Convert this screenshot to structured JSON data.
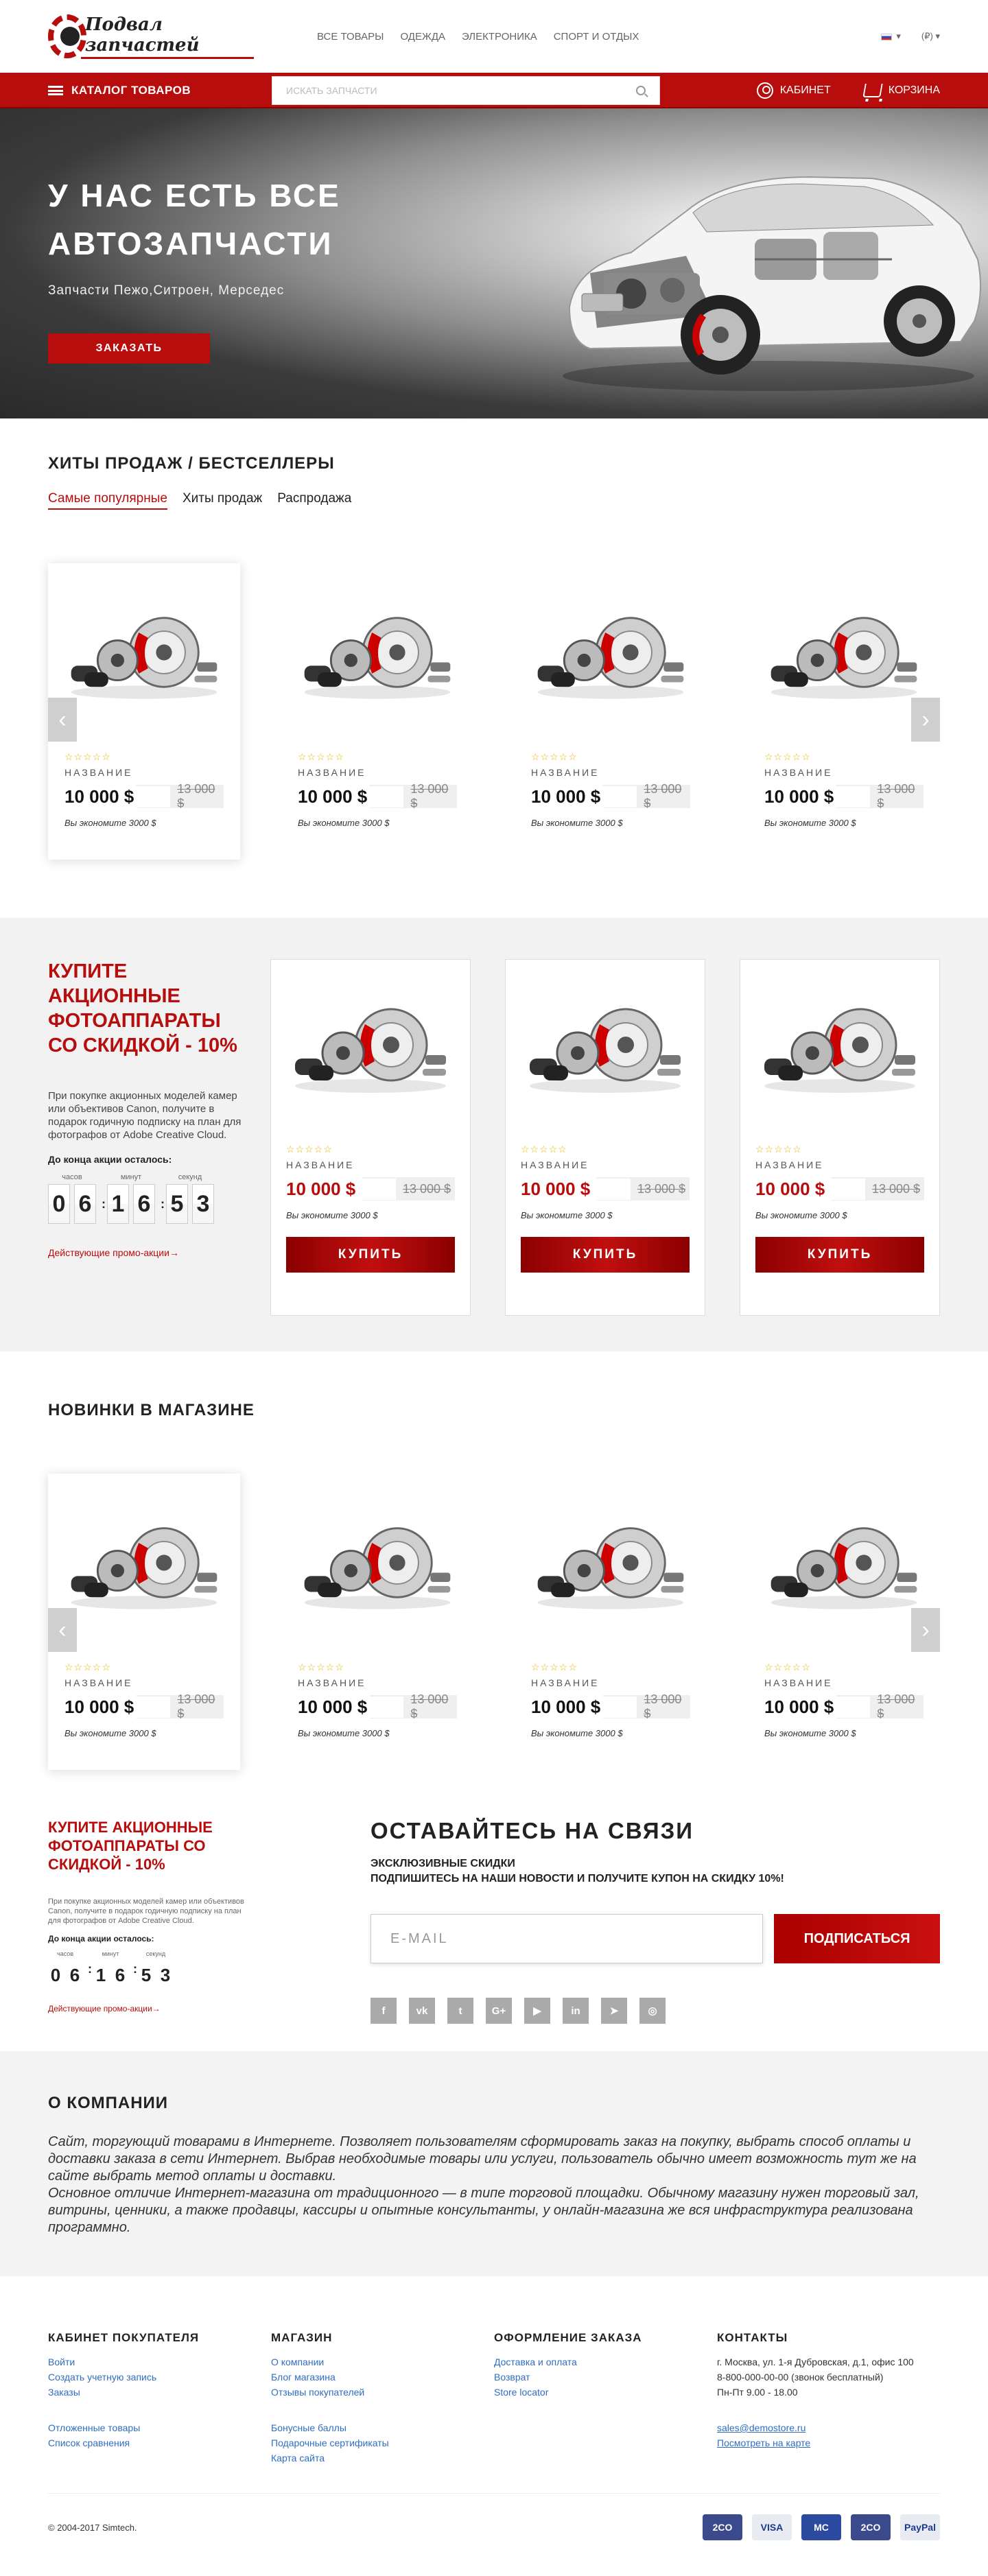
{
  "header": {
    "logo_text": "Подвал запчастей",
    "nav": [
      "Все товары",
      "Одежда",
      "Электроника",
      "Спорт и отдых"
    ],
    "lang_caret": "▾",
    "currency": "(₽) ▾"
  },
  "bar": {
    "catalog": "Каталог товаров",
    "search_placeholder": "искать запчасти",
    "cabinet": "Кабинет",
    "cart": "Корзина"
  },
  "hero": {
    "title": "У нас есть все автозапчасти",
    "subtitle": "Запчасти Пежо,Ситроен, Мерседес",
    "button": "Заказать"
  },
  "bestsellers": {
    "title": "Хиты продаж / бестселлеры",
    "tabs": [
      "Самые популярные",
      "Хиты продаж",
      "Распродажа"
    ],
    "products": [
      {
        "stars": "☆☆☆☆☆",
        "name": "название",
        "price": "10 000 $",
        "old": "13 000 $",
        "save": "Вы экономите 3000 $"
      },
      {
        "stars": "☆☆☆☆☆",
        "name": "название",
        "price": "10 000 $",
        "old": "13 000 $",
        "save": "Вы экономите 3000 $"
      },
      {
        "stars": "☆☆☆☆☆",
        "name": "название",
        "price": "10 000 $",
        "old": "13 000 $",
        "save": "Вы экономите 3000 $"
      },
      {
        "stars": "☆☆☆☆☆",
        "name": "название",
        "price": "10 000 $",
        "old": "13 000 $",
        "save": "Вы экономите 3000 $"
      }
    ]
  },
  "arrows": {
    "left": "‹",
    "right": "›"
  },
  "promo": {
    "title": "Купите акционные фотоаппараты со скидкой - 10%",
    "text": "При покупке акционных моделей камер или объективов Canon, получите в подарок годичную подписку на план для фотографов от Adobe Creative Cloud.",
    "deadline": "До конца акции осталось:",
    "labels": [
      "часов",
      "минут",
      "секунд"
    ],
    "hours": [
      "0",
      "6"
    ],
    "minutes": [
      "1",
      "6"
    ],
    "seconds": [
      "5",
      "3"
    ],
    "colon": ":",
    "link": "Действующие промо-акции→",
    "buy": "Купить",
    "products": [
      {
        "stars": "☆☆☆☆☆",
        "name": "название",
        "price": "10 000 $",
        "old": "13 000 $",
        "save": "Вы экономите 3000 $"
      },
      {
        "stars": "☆☆☆☆☆",
        "name": "название",
        "price": "10 000 $",
        "old": "13 000 $",
        "save": "Вы экономите 3000 $"
      },
      {
        "stars": "☆☆☆☆☆",
        "name": "название",
        "price": "10 000 $",
        "old": "13 000 $",
        "save": "Вы экономите 3000 $"
      }
    ]
  },
  "newarrivals": {
    "title": "Новинки в магазине",
    "products": [
      {
        "stars": "☆☆☆☆☆",
        "name": "название",
        "price": "10 000 $",
        "old": "13 000 $",
        "save": "Вы экономите 3000 $"
      },
      {
        "stars": "☆☆☆☆☆",
        "name": "название",
        "price": "10 000 $",
        "old": "13 000 $",
        "save": "Вы экономите 3000 $"
      },
      {
        "stars": "☆☆☆☆☆",
        "name": "название",
        "price": "10 000 $",
        "old": "13 000 $",
        "save": "Вы экономите 3000 $"
      },
      {
        "stars": "☆☆☆☆☆",
        "name": "название",
        "price": "10 000 $",
        "old": "13 000 $",
        "save": "Вы экономите 3000 $"
      }
    ]
  },
  "newsletter": {
    "title": "Оставайтесь на связи",
    "subtitle": "Эксклюзивные скидки",
    "subtitle2": "Подпишитесь на наши новости и получите купон на скидку 10%!",
    "placeholder": "E-MAIL",
    "button": "Подписаться",
    "social": [
      "f",
      "vk",
      "t",
      "G+",
      "▶",
      "in",
      "➤",
      "◎"
    ]
  },
  "about": {
    "title": "О компании",
    "text": "Сайт, торгующий товарами в Интернете. Позволяет пользователям сформировать заказ на покупку, выбрать способ оплаты и доставки заказа в сети Интернет. Выбрав необходимые товары или услуги, пользователь обычно имеет возможность тут же на сайте выбрать метод оплаты и доставки.",
    "text2": "Основное отличие Интернет-магазина от традиционного — в типе торговой площадки. Обычному магазину нужен торговый зал, витрины, ценники, а также продавцы, кассиры и опытные консультанты, у онлайн-магазина же вся инфраструктура реализована программно."
  },
  "footer": {
    "col1": {
      "title": "Кабинет покупателя",
      "links": [
        "Войти",
        "Создать учетную запись",
        "Заказы"
      ],
      "links2": [
        "Отложенные товары",
        "Список сравнения"
      ]
    },
    "col2": {
      "title": "Магазин",
      "links": [
        "О компании",
        "Блог магазина",
        "Отзывы покупателей"
      ],
      "links2": [
        "Бонусные баллы",
        "Подарочные сертификаты",
        "Карта сайта"
      ]
    },
    "col3": {
      "title": "Оформление заказа",
      "links": [
        "Доставка и оплата",
        "Возврат",
        "Store locator"
      ]
    },
    "col4": {
      "title": "Контакты",
      "address": "г. Москва, ул. 1-я Дубровская, д.1, офис 100",
      "phone": "8-800-000-00-00 (звонок бесплатный)",
      "hours": "Пн-Пт 9.00 - 18.00",
      "email": "sales@demostore.ru",
      "map": "Посмотреть на карте"
    },
    "copyright": "© 2004-2017 Simtech.",
    "payments": [
      {
        "label": "2CO",
        "color": "#3b4a8c"
      },
      {
        "label": "VISA",
        "color": "#e8ecf2"
      },
      {
        "label": "MC",
        "color": "#2b4aa0"
      },
      {
        "label": "2CO",
        "color": "#3b4a8c"
      },
      {
        "label": "PayPal",
        "color": "#e8ecf2"
      }
    ]
  }
}
